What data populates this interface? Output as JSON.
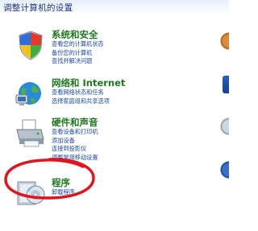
{
  "heading": "调整计算机的设置",
  "categories": [
    {
      "title": "系统和安全",
      "icon": "shield-icon",
      "links": [
        "查看您的计算机状态",
        "备份您的计算机",
        "查找并解决问题"
      ]
    },
    {
      "title": "网络和 Internet",
      "icon": "network-globe-icon",
      "links": [
        "查看网络状态和任务",
        "选择家庭组和共享选项"
      ]
    },
    {
      "title": "硬件和声音",
      "icon": "printer-icon",
      "links": [
        "查看设备和打印机",
        "添加设备",
        "连接到投影仪",
        "调整常用移动设置"
      ]
    },
    {
      "title": "程序",
      "icon": "programs-disc-icon",
      "links": [
        "卸载程序"
      ]
    }
  ],
  "colors": {
    "heading": "#1e3287",
    "category_title": "#1f7a1f",
    "link": "#1e4aa8",
    "highlight_ring": "#e0141e"
  }
}
